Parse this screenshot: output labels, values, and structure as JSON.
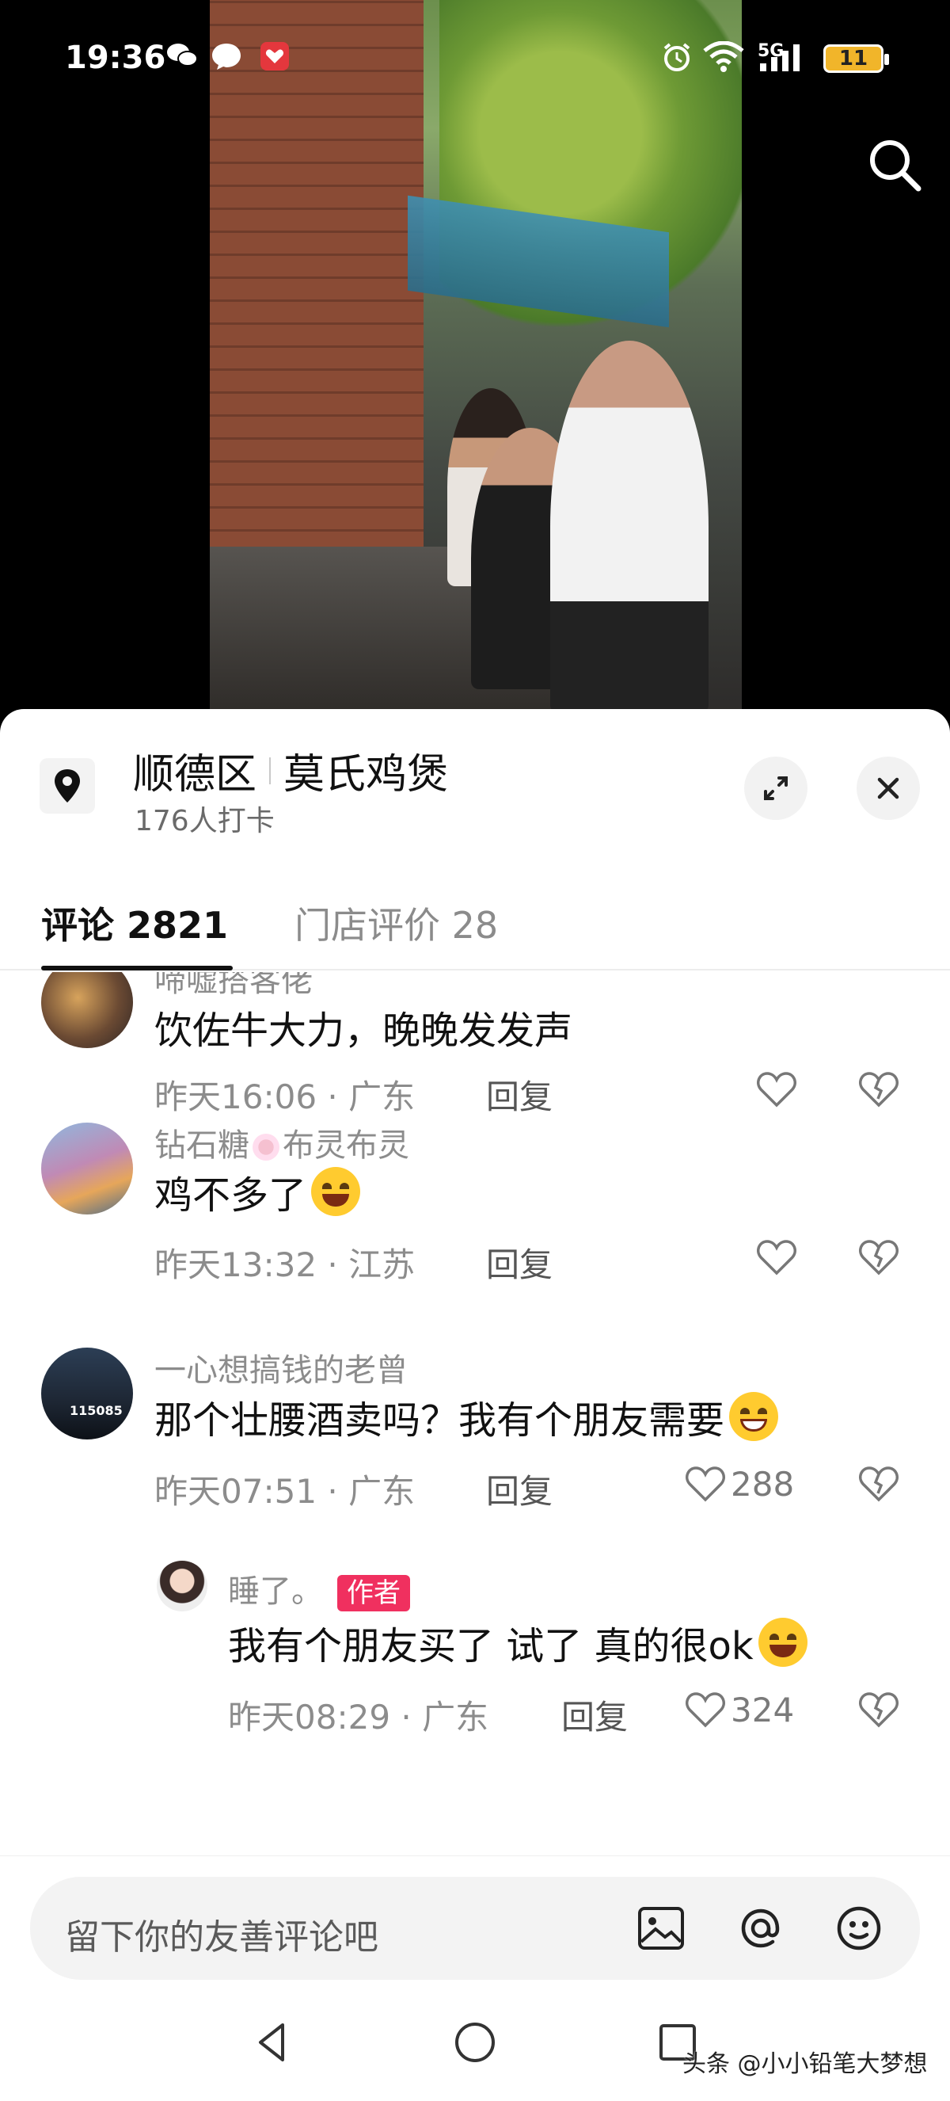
{
  "status_bar": {
    "time": "19:36",
    "network": "5G",
    "battery": "11",
    "icons": [
      "wechat-icon",
      "chat-bubble-icon",
      "app-badge-icon",
      "alarm-icon",
      "wifi-icon",
      "signal-icon"
    ]
  },
  "location": {
    "district": "顺德区",
    "shop": "莫氏鸡煲",
    "checkins": "176人打卡"
  },
  "tabs": {
    "comments_label": "评论 2821",
    "reviews_label": "门店评价 28"
  },
  "comments": [
    {
      "username": "啼嘘搭客佬",
      "text": "饮佐牛大力，晚晚发发声",
      "time": "昨天16:06 · 广东",
      "reply": "回复",
      "likes": ""
    },
    {
      "username_part1": "钻石糖",
      "username_part2": "布灵布灵",
      "text": "鸡不多了",
      "time": "昨天13:32 · 江苏",
      "reply": "回复",
      "likes": ""
    },
    {
      "username": "一心想搞钱的老曾",
      "text": "那个壮腰酒卖吗？我有个朋友需要",
      "time": "昨天07:51 · 广东",
      "reply": "回复",
      "likes": "288",
      "avatar_text": "115085"
    },
    {
      "username": "睡了。",
      "badge": "作者",
      "text": "我有个朋友买了 试了 真的很ok",
      "time": "昨天08:29 · 广东",
      "reply": "回复",
      "likes": "324"
    }
  ],
  "input": {
    "placeholder": "留下你的友善评论吧"
  },
  "watermark": "头条 @小小铅笔大梦想",
  "colors": {
    "accent": "#f0305f",
    "battery": "#f1b52a",
    "muted_text": "#8c8c8c"
  }
}
